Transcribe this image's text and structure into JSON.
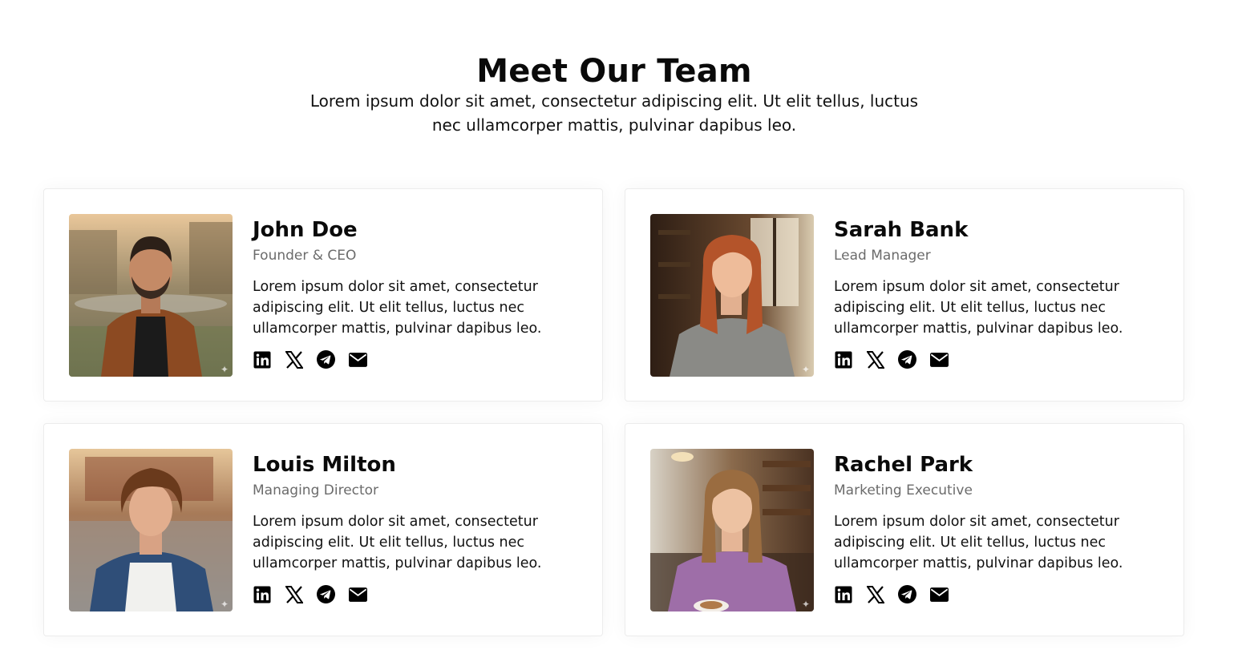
{
  "header": {
    "title": "Meet Our Team",
    "subtitle": "Lorem ipsum dolor sit amet, consectetur adipiscing elit. Ut elit tellus, luctus nec ullamcorper mattis, pulvinar dapibus leo."
  },
  "team": [
    {
      "name": "John Doe",
      "role": "Founder & CEO",
      "bio": "Lorem ipsum dolor sit amet, consectetur adipiscing elit. Ut elit tellus, luctus nec ullamcorper mattis, pulvinar dapibus leo.",
      "icons": [
        "linkedin-icon",
        "x-icon",
        "telegram-icon",
        "email-icon"
      ]
    },
    {
      "name": "Sarah Bank",
      "role": "Lead Manager",
      "bio": "Lorem ipsum dolor sit amet, consectetur adipiscing elit. Ut elit tellus, luctus nec ullamcorper mattis, pulvinar dapibus leo.",
      "icons": [
        "linkedin-icon",
        "x-icon",
        "telegram-icon",
        "email-icon"
      ]
    },
    {
      "name": "Louis Milton",
      "role": "Managing Director",
      "bio": "Lorem ipsum dolor sit amet, consectetur adipiscing elit. Ut elit tellus, luctus nec ullamcorper mattis, pulvinar dapibus leo.",
      "icons": [
        "linkedin-icon",
        "x-icon",
        "telegram-icon",
        "email-icon"
      ]
    },
    {
      "name": "Rachel Park",
      "role": "Marketing Executive",
      "bio": "Lorem ipsum dolor sit amet, consectetur adipiscing elit. Ut elit tellus, luctus nec ullamcorper mattis, pulvinar dapibus leo.",
      "icons": [
        "linkedin-icon",
        "x-icon",
        "telegram-icon",
        "email-icon"
      ]
    }
  ],
  "colors": {
    "text": "#111111",
    "muted": "#6b6b6b",
    "card_border": "#ececec",
    "icon": "#000000"
  }
}
